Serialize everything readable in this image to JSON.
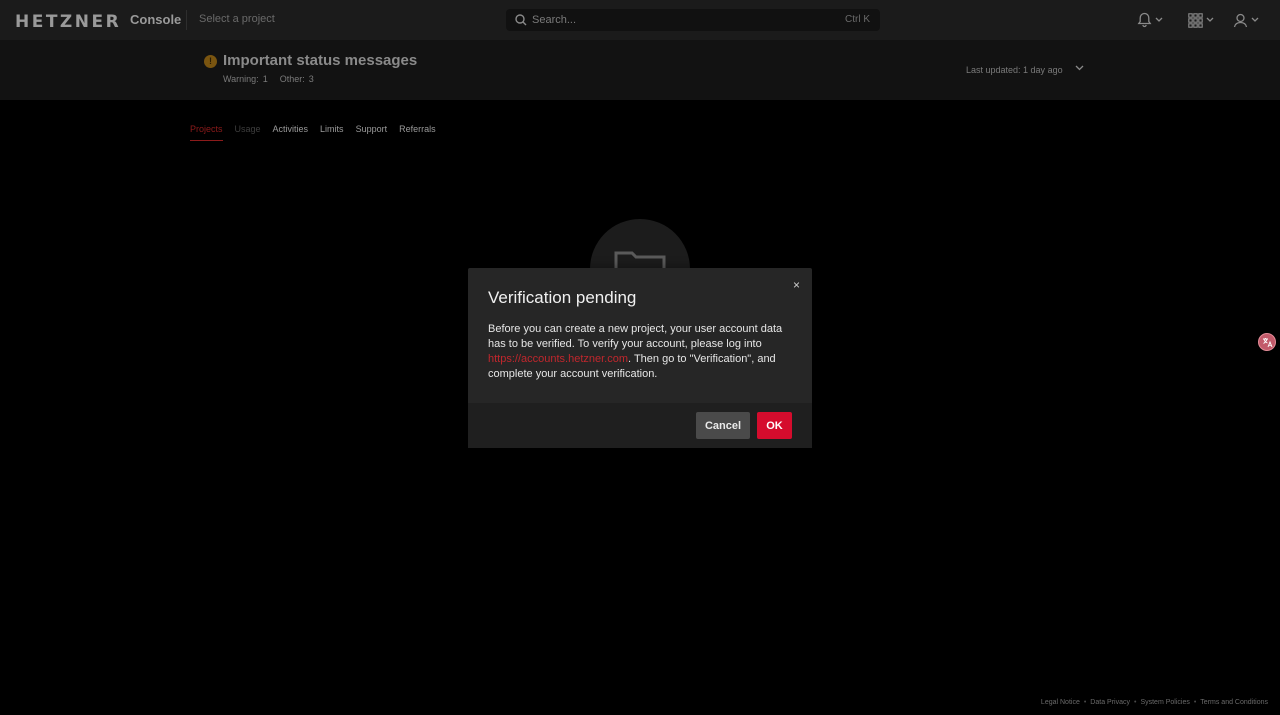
{
  "header": {
    "logo": "HETZNER",
    "product": "Console",
    "project_selector": "Select a project",
    "search_placeholder": "Search...",
    "search_shortcut": "Ctrl K",
    "icons": [
      "bell-icon",
      "apps-grid-icon",
      "user-icon"
    ]
  },
  "status_messages": {
    "title": "Important status messages",
    "warning_label": "Warning:",
    "warning_count": "1",
    "other_label": "Other:",
    "other_count": "3",
    "last_updated": "Last updated:  1 day ago"
  },
  "tabs": [
    {
      "label": "Projects",
      "state": "active"
    },
    {
      "label": "Usage",
      "state": "disabled"
    },
    {
      "label": "Activities",
      "state": "normal"
    },
    {
      "label": "Limits",
      "state": "normal"
    },
    {
      "label": "Support",
      "state": "normal"
    },
    {
      "label": "Referrals",
      "state": "normal"
    }
  ],
  "modal": {
    "title": "Verification pending",
    "close": "×",
    "body_before_link": "Before you can create a new project, your user account data has to be verified. To verify your account, please log into ",
    "link": "https://accounts.hetzner.com",
    "body_after_link": ". Then go to \"Verification\", and complete your account verification.",
    "cancel_label": "Cancel",
    "ok_label": "OK"
  },
  "footer": {
    "links": [
      "Legal Notice",
      "Data Privacy",
      "System Policies",
      "Terms and Conditions"
    ]
  },
  "colors": {
    "accent": "#d50c2d",
    "warning": "#7a5510"
  }
}
